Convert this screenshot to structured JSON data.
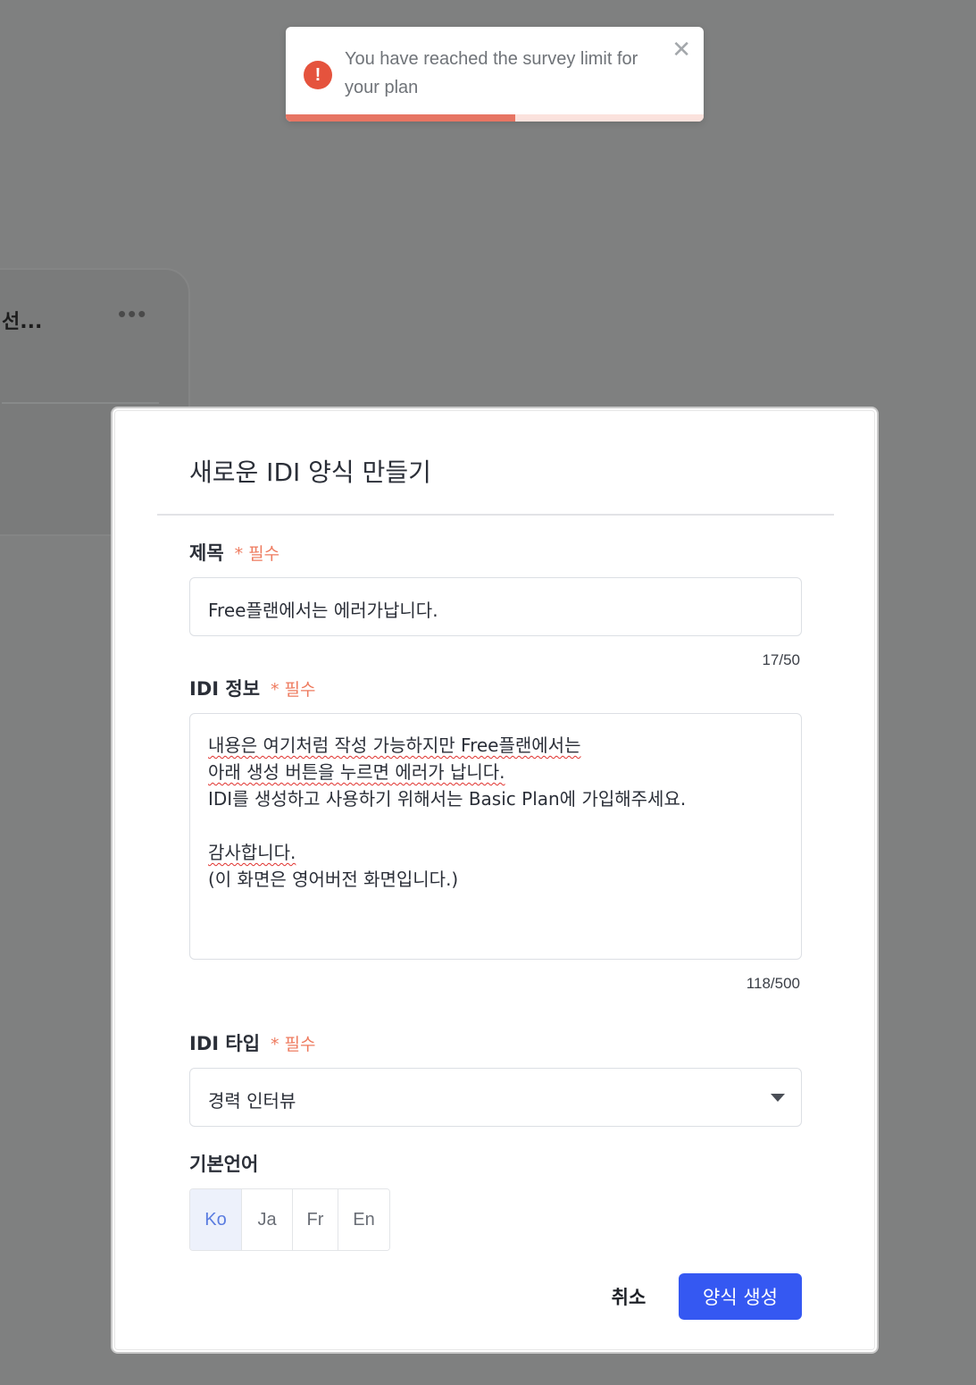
{
  "background_card": {
    "title": "선...",
    "more_label": "•••"
  },
  "toast": {
    "icon": "exclamation-icon",
    "message": "You have reached the survey limit for your plan",
    "close_label": "✕",
    "progress": 0.55
  },
  "modal": {
    "title": "새로운 IDI 양식 만들기",
    "required_label": "* 필수",
    "title_field": {
      "label": "제목",
      "value": "Free플랜에서는 에러가납니다.",
      "counter": "17/50"
    },
    "info_field": {
      "label": "IDI 정보",
      "lines": [
        "내용은 여기처럼 작성 가능하지만 Free플랜에서는",
        "아래 생성 버튼을 누르면 에러가 납니다.",
        "IDI를 생성하고 사용하기 위해서는 Basic Plan에 가입해주세요.",
        "",
        "감사합니다.",
        "(이 화면은 영어버전 화면입니다.)"
      ],
      "counter": "118/500"
    },
    "type_field": {
      "label": "IDI 타입",
      "selected": "경력 인터뷰"
    },
    "language_field": {
      "label": "기본언어",
      "options": [
        "Ko",
        "Ja",
        "Fr",
        "En"
      ],
      "selected": "Ko"
    },
    "cancel_label": "취소",
    "create_label": "양식 생성"
  },
  "colors": {
    "backdrop": "#7f8080",
    "accent": "#3558f2",
    "error": "#e5533d",
    "required": "#ee7b5f"
  }
}
